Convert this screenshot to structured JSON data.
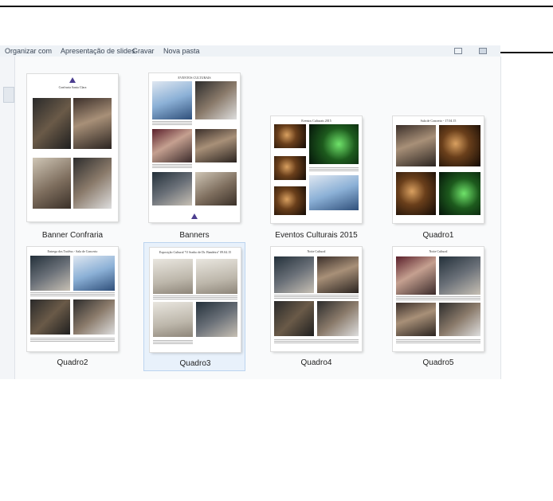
{
  "toolbar": {
    "organize": "Organizar com",
    "slideshow": "Apresentação de slides",
    "burn": "Gravar",
    "new_folder": "Nova pasta"
  },
  "files": [
    {
      "name": "Banner Confraria",
      "caption": "Confraria Santa Clara",
      "selected": false
    },
    {
      "name": "Banners",
      "caption": "EVENTOS CULTURAIS",
      "selected": false
    },
    {
      "name": "Eventos Culturais 2015",
      "caption": "Eventos Culturais 2015",
      "selected": false
    },
    {
      "name": "Quadro1",
      "caption": "Sala de Concerto - 17.04.15",
      "selected": false
    },
    {
      "name": "Quadro2",
      "caption": "Entrega dos Troféus - Sala de Concerto",
      "selected": false
    },
    {
      "name": "Quadro3",
      "caption": "Exposição Cultural \"O Sonho de Dr. Bandeira\" 09.04.15",
      "selected": true
    },
    {
      "name": "Quadro4",
      "caption": "Noite Cultural",
      "selected": false
    },
    {
      "name": "Quadro5",
      "caption": "Noite Cultural",
      "selected": false
    }
  ],
  "colors": {
    "selection_bg": "#e8f1fb",
    "selection_border": "#bcd4ef",
    "toolbar_bg": "#eef2f6"
  },
  "icons": [
    "grid-view-icon",
    "preview-pane-icon",
    "logo-icon"
  ]
}
